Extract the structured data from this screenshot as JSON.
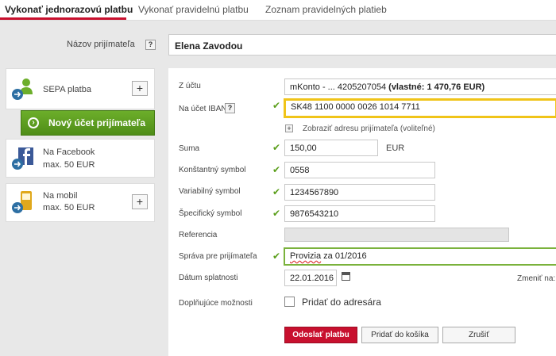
{
  "tabs": [
    {
      "label": "Vykonať jednorazovú platbu"
    },
    {
      "label": "Vykonať pravidelnú platbu"
    },
    {
      "label": "Zoznam pravidelných platieb"
    }
  ],
  "recipient": {
    "label": "Názov prijímateľa",
    "help": "?",
    "value": "Elena Zavodou"
  },
  "sidebar": {
    "sepa": {
      "label": "SEPA platba",
      "plus": "+"
    },
    "new_account": {
      "label": "Nový účet prijímateľa",
      "icon": "arrow-right-icon"
    },
    "facebook": {
      "line1": "Na Facebook",
      "line2": "max. 50 EUR"
    },
    "mobile": {
      "line1": "Na mobil",
      "line2": "max. 50 EUR",
      "plus": "+"
    }
  },
  "form": {
    "from_account": {
      "label": "Z účtu",
      "value_prefix": "mKonto - ... 4205207054 ",
      "value_bold": "(vlastné: 1 470,76 EUR)"
    },
    "iban": {
      "label": "Na účet IBAN",
      "help": "?",
      "value": "SK48 1100 0000 0026 1014 7711"
    },
    "show_address": {
      "plus": "+",
      "label": "Zobraziť adresu prijímateľa (voliteľné)"
    },
    "amount": {
      "label": "Suma",
      "value": "150,00",
      "currency": "EUR"
    },
    "constant_symbol": {
      "label": "Konštantný symbol",
      "value": "0558"
    },
    "variable_symbol": {
      "label": "Variabilný symbol",
      "value": "1234567890"
    },
    "specific_symbol": {
      "label": "Špecifický symbol",
      "value": "9876543210"
    },
    "reference": {
      "label": "Referencia",
      "value": ""
    },
    "message": {
      "label": "Správa pre prijímateľa",
      "word1": "Provizia",
      "rest": " za 01/2016"
    },
    "due_date": {
      "label": "Dátum splatnosti",
      "value": "22.01.2016",
      "change_label": "Zmeniť na:"
    },
    "extra": {
      "label": "Doplňujúce možnosti",
      "checkbox_label": "Pridať do adresára"
    },
    "check_mark": "✔"
  },
  "buttons": {
    "send": "Odoslať platbu",
    "add_cart": "Pridať do košíka",
    "cancel": "Zrušiť"
  },
  "colors": {
    "accent_red": "#c8102e",
    "accent_green": "#5a9e1a",
    "highlight_yellow": "#f0c419"
  }
}
